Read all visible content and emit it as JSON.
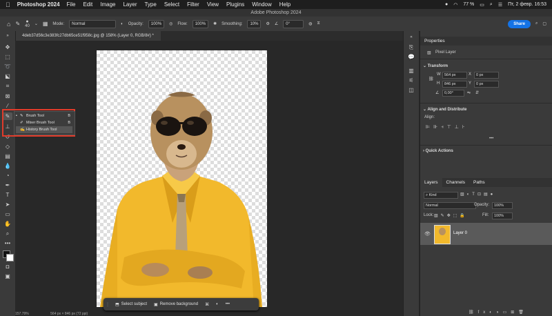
{
  "menubar": {
    "app": "Photoshop 2024",
    "items": [
      "File",
      "Edit",
      "Image",
      "Layer",
      "Type",
      "Select",
      "Filter",
      "View",
      "Plugins",
      "Window",
      "Help"
    ],
    "battery": "77 %",
    "datetime": "Пт, 2 февр.  16:53"
  },
  "window_title": "Adobe Photoshop 2024",
  "options": {
    "brush_size": "40",
    "mode_label": "Mode:",
    "mode_value": "Normal",
    "opacity_label": "Opacity:",
    "opacity_value": "100%",
    "flow_label": "Flow:",
    "flow_value": "100%",
    "smoothing_label": "Smoothing:",
    "smoothing_value": "10%",
    "angle_value": "0°",
    "share_label": "Share"
  },
  "document_tab": "4deb37d56c3e383fc27db65ce51f958c.jpg @ 158% (Layer 0, RGB/8#) *",
  "flyout": {
    "items": [
      {
        "label": "Brush Tool",
        "shortcut": "B",
        "selected": false,
        "checked": true
      },
      {
        "label": "Mixer Brush Tool",
        "shortcut": "B",
        "selected": false,
        "checked": false
      },
      {
        "label": "History Brush Tool",
        "shortcut": "",
        "selected": true,
        "checked": false
      }
    ]
  },
  "context_bar": {
    "select_subject": "Select subject",
    "remove_background": "Remove background",
    "more": "•••"
  },
  "status": {
    "zoom": "157.79%",
    "size": "564 px × 846 px (72 ppi)"
  },
  "properties": {
    "title": "Properties",
    "kind": "Pixel Layer",
    "transform_label": "Transform",
    "w_label": "W",
    "w_value": "564 px",
    "h_label": "H",
    "h_value": "846 px",
    "x_label": "X",
    "x_value": "0 px",
    "y_label": "Y",
    "y_value": "0 px",
    "angle_value": "0,00°",
    "align_label": "Align and Distribute",
    "align_sub": "Align:",
    "more": "•••",
    "quick_actions": "Quick Actions"
  },
  "layers": {
    "tabs": [
      "Layers",
      "Channels",
      "Paths"
    ],
    "filter_kind": "Kind",
    "blend_mode": "Normal",
    "opacity_label": "Opacity:",
    "opacity_value": "100%",
    "lock_label": "Lock:",
    "fill_label": "Fill:",
    "fill_value": "100%",
    "layer_name": "Layer 0"
  },
  "colors": {
    "accent": "#1473e6",
    "highlight": "#e23b2a",
    "suit": "#f2b92c"
  }
}
